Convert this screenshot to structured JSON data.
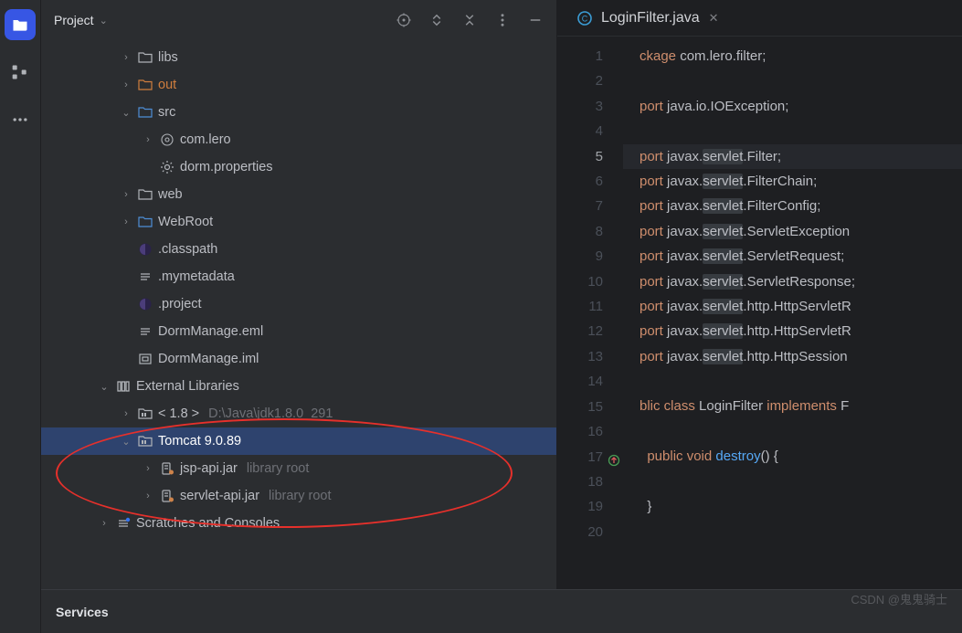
{
  "activity": {
    "names": [
      "project-explorer-icon",
      "structure-icon",
      "more-icon"
    ]
  },
  "panel": {
    "title": "Project",
    "actions": [
      "target-icon",
      "expand-icon",
      "collapse-icon",
      "more-icon",
      "hide-icon"
    ]
  },
  "tree": [
    {
      "ind": "i1",
      "arr": ">",
      "ico": "folder",
      "lbl": "libs",
      "cls": ""
    },
    {
      "ind": "i1",
      "arr": ">",
      "ico": "folder-o",
      "lbl": "out",
      "cls": "orange"
    },
    {
      "ind": "i1",
      "arr": "v",
      "ico": "folder-src",
      "lbl": "src",
      "cls": ""
    },
    {
      "ind": "i2",
      "arr": ">",
      "ico": "pkg",
      "lbl": "com.lero",
      "cls": ""
    },
    {
      "ind": "i2",
      "arr": "",
      "ico": "gear",
      "lbl": "dorm.properties",
      "cls": ""
    },
    {
      "ind": "i1",
      "arr": ">",
      "ico": "folder",
      "lbl": "web",
      "cls": ""
    },
    {
      "ind": "i1",
      "arr": ">",
      "ico": "folder-web",
      "lbl": "WebRoot",
      "cls": ""
    },
    {
      "ind": "i1",
      "arr": "",
      "ico": "ecl",
      "lbl": ".classpath",
      "cls": ""
    },
    {
      "ind": "i1",
      "arr": "",
      "ico": "txt",
      "lbl": ".mymetadata",
      "cls": ""
    },
    {
      "ind": "i1",
      "arr": "",
      "ico": "ecl",
      "lbl": ".project",
      "cls": ""
    },
    {
      "ind": "i1",
      "arr": "",
      "ico": "txt",
      "lbl": "DormManage.eml",
      "cls": ""
    },
    {
      "ind": "i1",
      "arr": "",
      "ico": "iml",
      "lbl": "DormManage.iml",
      "cls": ""
    },
    {
      "ind": "iE",
      "arr": "v",
      "ico": "lib",
      "lbl": "External Libraries",
      "cls": ""
    },
    {
      "ind": "iL",
      "arr": ">",
      "ico": "libf",
      "lbl": "< 1.8 >",
      "mute": "D:\\Java\\jdk1.8.0_291",
      "cls": ""
    },
    {
      "ind": "iL",
      "arr": "v",
      "ico": "libf",
      "lbl": "Tomcat 9.0.89",
      "cls": "",
      "sel": true
    },
    {
      "ind": "iJ",
      "arr": ">",
      "ico": "jar",
      "lbl": "jsp-api.jar",
      "mute": "library root",
      "cls": ""
    },
    {
      "ind": "iJ",
      "arr": ">",
      "ico": "jar",
      "lbl": "servlet-api.jar",
      "mute": "library root",
      "cls": ""
    },
    {
      "ind": "iE",
      "arr": ">",
      "ico": "scr",
      "lbl": "Scratches and Consoles",
      "cls": ""
    }
  ],
  "tab": {
    "name": "LoginFilter.java"
  },
  "code": {
    "lines": [
      {
        "n": 1,
        "t": [
          [
            "kw",
            "ckage"
          ],
          [
            "str",
            " com.lero.filter"
          ],
          [
            "str",
            ";"
          ]
        ]
      },
      {
        "n": 2,
        "t": []
      },
      {
        "n": 3,
        "t": [
          [
            "kw",
            "port"
          ],
          [
            "str",
            " java.io.IOException"
          ],
          [
            "str",
            ";"
          ]
        ]
      },
      {
        "n": 4,
        "t": []
      },
      {
        "n": 5,
        "hl": true,
        "t": [
          [
            "kw",
            "port"
          ],
          [
            "str",
            " javax."
          ],
          [
            "sh",
            "servlet"
          ],
          [
            "str",
            ".Filter"
          ],
          [
            "str",
            ";"
          ]
        ]
      },
      {
        "n": 6,
        "t": [
          [
            "kw",
            "port"
          ],
          [
            "str",
            " javax."
          ],
          [
            "sh",
            "servlet"
          ],
          [
            "str",
            ".FilterChain"
          ],
          [
            "str",
            ";"
          ]
        ]
      },
      {
        "n": 7,
        "t": [
          [
            "kw",
            "port"
          ],
          [
            "str",
            " javax."
          ],
          [
            "sh",
            "servlet"
          ],
          [
            "str",
            ".FilterConfig"
          ],
          [
            "str",
            ";"
          ]
        ]
      },
      {
        "n": 8,
        "t": [
          [
            "kw",
            "port"
          ],
          [
            "str",
            " javax."
          ],
          [
            "sh",
            "servlet"
          ],
          [
            "str",
            ".ServletException"
          ]
        ]
      },
      {
        "n": 9,
        "t": [
          [
            "kw",
            "port"
          ],
          [
            "str",
            " javax."
          ],
          [
            "sh",
            "servlet"
          ],
          [
            "str",
            ".ServletRequest"
          ],
          [
            "str",
            ";"
          ]
        ]
      },
      {
        "n": 10,
        "t": [
          [
            "kw",
            "port"
          ],
          [
            "str",
            " javax."
          ],
          [
            "sh",
            "servlet"
          ],
          [
            "str",
            ".ServletResponse"
          ],
          [
            "str",
            ";"
          ]
        ]
      },
      {
        "n": 11,
        "t": [
          [
            "kw",
            "port"
          ],
          [
            "str",
            " javax."
          ],
          [
            "sh",
            "servlet"
          ],
          [
            "str",
            ".http.HttpServletR"
          ]
        ]
      },
      {
        "n": 12,
        "t": [
          [
            "kw",
            "port"
          ],
          [
            "str",
            " javax."
          ],
          [
            "sh",
            "servlet"
          ],
          [
            "str",
            ".http.HttpServletR"
          ]
        ]
      },
      {
        "n": 13,
        "t": [
          [
            "kw",
            "port"
          ],
          [
            "str",
            " javax."
          ],
          [
            "sh",
            "servlet"
          ],
          [
            "str",
            ".http.HttpSession"
          ]
        ]
      },
      {
        "n": 14,
        "t": []
      },
      {
        "n": 15,
        "t": [
          [
            "kw",
            "blic class"
          ],
          [
            "str",
            " LoginFilter "
          ],
          [
            "kw",
            "implements"
          ],
          [
            "str",
            " F"
          ]
        ]
      },
      {
        "n": 16,
        "t": []
      },
      {
        "n": 17,
        "mark": "override",
        "t": [
          [
            "str",
            "  "
          ],
          [
            "kw",
            "public void"
          ],
          [
            "str",
            " "
          ],
          [
            "fn",
            "destroy"
          ],
          [
            "str",
            "() {"
          ]
        ]
      },
      {
        "n": 18,
        "t": []
      },
      {
        "n": 19,
        "t": [
          [
            "str",
            "  }"
          ]
        ]
      },
      {
        "n": 20,
        "t": []
      }
    ]
  },
  "services": {
    "title": "Services"
  },
  "watermark": "CSDN @鬼鬼骑士"
}
